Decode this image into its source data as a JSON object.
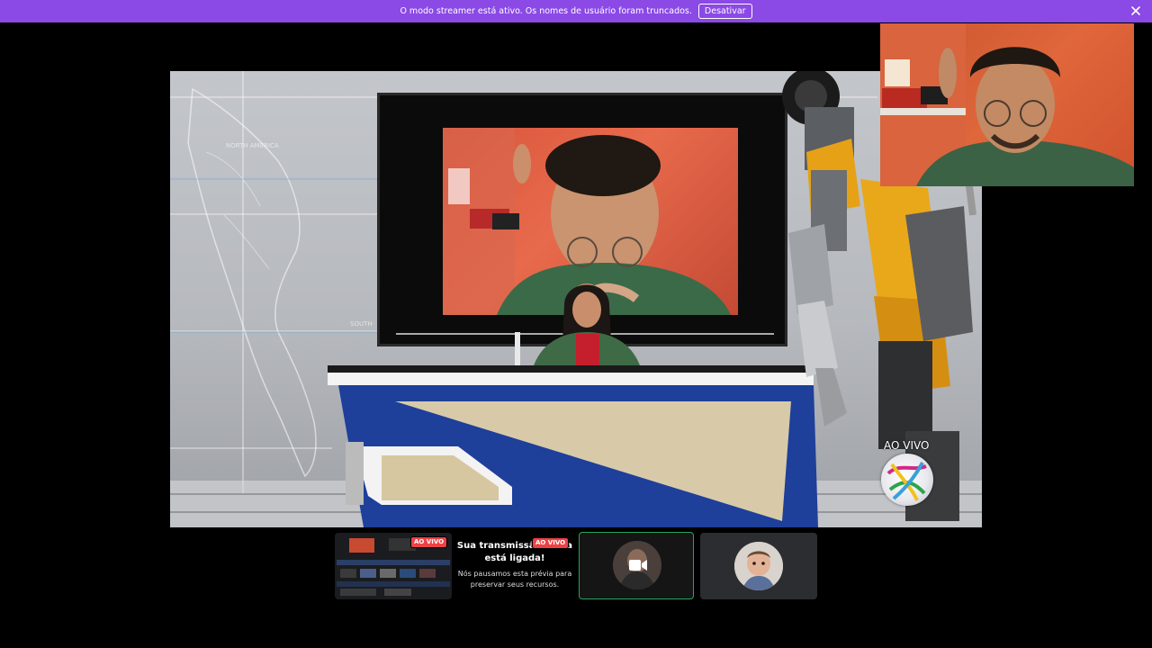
{
  "banner": {
    "message": "O modo streamer está ativo. Os nomes de usuário foram truncados.",
    "button_label": "Desativar",
    "close_icon": "close-icon",
    "background": "#8b49e6"
  },
  "stage": {
    "map_label_north": "NORTH AMERICA",
    "map_label_south": "SOUTH",
    "live_label": "AO VIVO"
  },
  "bottom": {
    "stream_badge": "AO VIVO",
    "info_badge": "AO VIVO",
    "info_title": "Sua transmissão ainda está ligada!",
    "info_subtitle": "Nós pausamos esta prévia para preservar seus recursos.",
    "camera_icon": "camera-icon",
    "active_border": "#23a55a"
  }
}
